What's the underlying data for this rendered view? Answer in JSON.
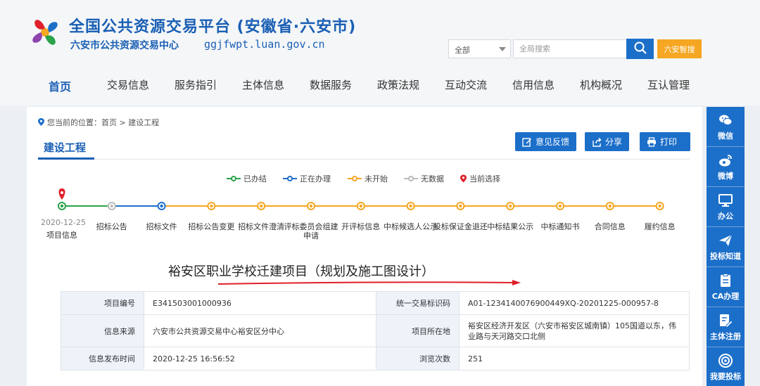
{
  "header": {
    "title": "全国公共资源交易平台 (安徽省·六安市)",
    "subtitle": "六安市公共资源交易中心",
    "domain": "ggjfwpt.luan.gov.cn",
    "search_select": "全部",
    "search_placeholder": "全局搜索",
    "manage_label": "六安智搜"
  },
  "nav": [
    "首页",
    "交易信息",
    "服务指引",
    "主体信息",
    "数据服务",
    "政策法规",
    "互动交流",
    "信用信息",
    "机构概况",
    "互认管理"
  ],
  "breadcrumb": "您当前的位置：首页 > 建设工程",
  "tab_title": "建设工程",
  "actions": {
    "feedback": "意见反馈",
    "share": "分享",
    "print": "打印"
  },
  "legend": {
    "done": "已办结",
    "doing": "正在办理",
    "notstarted": "未开始",
    "nodata": "无数据",
    "current": "当前选择"
  },
  "colors": {
    "done": "#2aa34a",
    "doing": "#1c6fc9",
    "notstarted": "#f5a623",
    "nodata": "#bbbbbb",
    "current": "#e0202a",
    "accent": "#1c6fc9"
  },
  "timeline": {
    "date": "2020-12-25",
    "steps": [
      {
        "label": "项目信息",
        "status": "done"
      },
      {
        "label": "招标公告",
        "status": "nodata"
      },
      {
        "label": "招标文件",
        "status": "doing"
      },
      {
        "label": "招标公告变更",
        "status": "notstarted"
      },
      {
        "label": "招标文件澄清",
        "status": "notstarted"
      },
      {
        "label": "评标委员会组建申请",
        "status": "notstarted"
      },
      {
        "label": "开评标信息",
        "status": "notstarted"
      },
      {
        "label": "中标候选人公示",
        "status": "notstarted"
      },
      {
        "label": "投标保证金退还",
        "status": "notstarted"
      },
      {
        "label": "中标结果公示",
        "status": "notstarted"
      },
      {
        "label": "中标通知书",
        "status": "notstarted"
      },
      {
        "label": "合同信息",
        "status": "notstarted"
      },
      {
        "label": "履约信息",
        "status": "notstarted"
      }
    ]
  },
  "project_title": "裕安区职业学校迁建项目（规划及施工图设计）",
  "info": {
    "rows": [
      {
        "k1": "项目编号",
        "v1": "E341503001000936",
        "k2": "统一交易标识码",
        "v2": "A01-1234140076900449XQ-20201225-000957-8"
      },
      {
        "k1": "信息来源",
        "v1": "六安市公共资源交易中心裕安区分中心",
        "k2": "项目所在地",
        "v2": "裕安区经济开发区（六安市裕安区城南镇）105国道以东，伟业路与天河路交口北侧"
      },
      {
        "k1": "信息发布时间",
        "v1": "2020-12-25 16:56:52",
        "k2": "浏览次数",
        "v2": "251"
      }
    ]
  },
  "sidebar": [
    "微信",
    "微博",
    "办公",
    "投标知道",
    "CA办理",
    "主体注册",
    "我要投标"
  ]
}
